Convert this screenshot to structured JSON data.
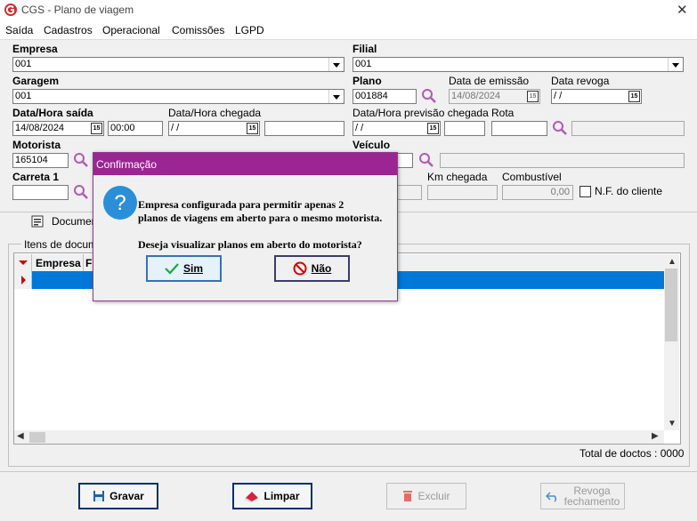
{
  "window": {
    "title": "CGS - Plano de viagem",
    "close_glyph": "✕"
  },
  "menu": [
    "Saída",
    "Cadastros",
    "Operacional",
    "Comissões",
    "LGPD"
  ],
  "form": {
    "empresa": {
      "label": "Empresa",
      "value": "001"
    },
    "filial": {
      "label": "Filial",
      "value": "001"
    },
    "garagem": {
      "label": "Garagem",
      "value": "001"
    },
    "plano": {
      "label": "Plano",
      "value": "001884"
    },
    "data_emissao": {
      "label": "Data de emissão",
      "value": "14/08/2024"
    },
    "data_revoga": {
      "label": "Data revoga",
      "value": " / /"
    },
    "data_saida": {
      "label": "Data/Hora saída",
      "date": "14/08/2024",
      "time": "00:00"
    },
    "data_chegada": {
      "label": "Data/Hora chegada",
      "date": " / /",
      "time": ""
    },
    "data_previsao": {
      "label": "Data/Hora previsão chegada",
      "date": " / /",
      "time": ""
    },
    "rota": {
      "label": "Rota",
      "value": ""
    },
    "motorista": {
      "label": "Motorista",
      "value": "165104"
    },
    "veiculo": {
      "label": "Veículo",
      "value": ""
    },
    "carreta": {
      "label": "Carreta 1",
      "value": ""
    },
    "km_chegada": {
      "label": "Km chegada",
      "value": ""
    },
    "combustivel": {
      "label": "Combustível",
      "value": "0,00"
    },
    "nf_cliente": {
      "label": "N.F. do cliente",
      "checked": false
    },
    "calendar_glyph": "15"
  },
  "tabs": {
    "documentos": "Documen"
  },
  "grid": {
    "group_label": "Itens de docume",
    "columns": [
      "Empresa",
      "F"
    ],
    "total": "Total de doctos : 0000"
  },
  "buttons": {
    "gravar": "Gravar",
    "limpar": "Limpar",
    "excluir": "Excluir",
    "revoga_line1": "Revoga",
    "revoga_line2": "fechamento"
  },
  "dialog": {
    "title": "Confirmação",
    "message_line1": "Empresa configurada para permitir apenas 2",
    "message_line2": "planos de viagens em aberto para o mesmo motorista.",
    "question": "Deseja visualizar planos em aberto do motorista?",
    "yes": "Sim",
    "no": "Não"
  },
  "colors": {
    "dialog_title": "#9b2592",
    "selection": "#0078d7",
    "search_icon": "#b05ab5",
    "logo": "#d42a2a"
  }
}
